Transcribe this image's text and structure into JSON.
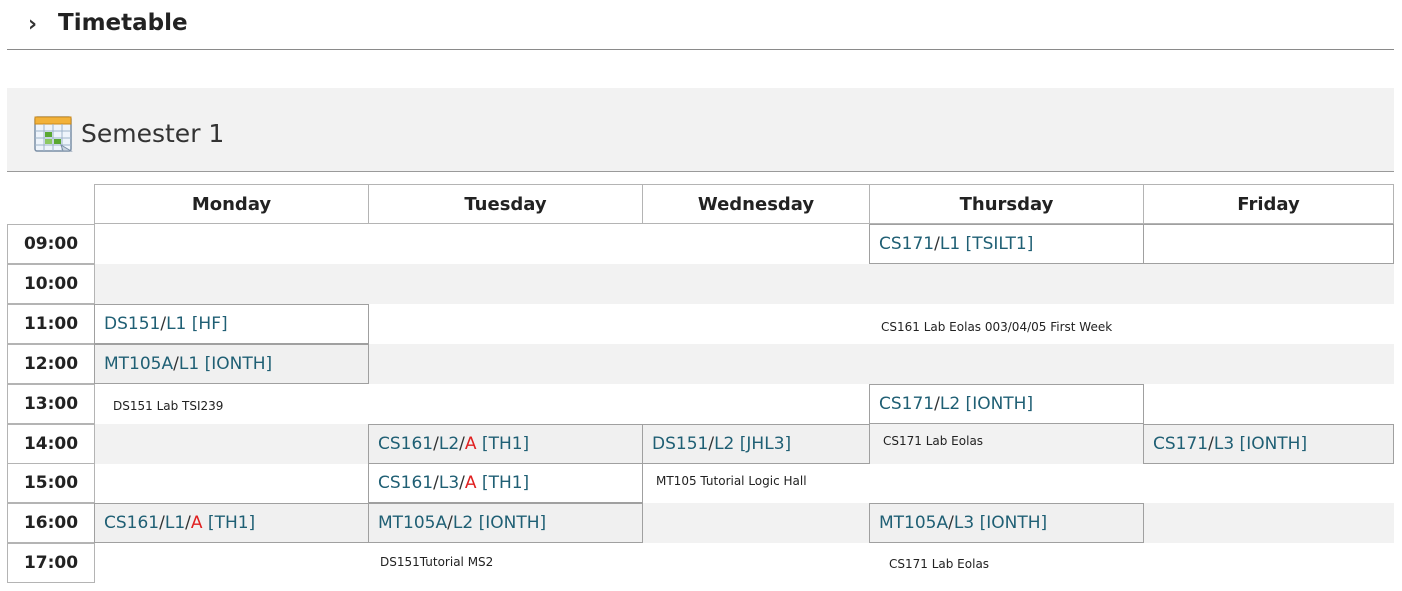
{
  "page": {
    "title": "Timetable",
    "chevron": "›",
    "semester_title": "Semester 1",
    "calendar_icon": "calendar-icon"
  },
  "days": [
    "Monday",
    "Tuesday",
    "Wednesday",
    "Thursday",
    "Friday"
  ],
  "times": [
    "09:00",
    "10:00",
    "11:00",
    "12:00",
    "13:00",
    "14:00",
    "15:00",
    "16:00",
    "17:00"
  ],
  "classes": [
    {
      "code": "CS171",
      "group": "L1",
      "room": "TSILT1"
    },
    {
      "code": "DS151",
      "group": "L1",
      "room": "HF"
    },
    {
      "code": "MT105A",
      "group": "L1",
      "room": "IONTH"
    },
    {
      "code": "CS171",
      "group": "L2",
      "room": "IONTH"
    },
    {
      "code": "CS161",
      "group": "L2",
      "flag": "A",
      "room": "TH1"
    },
    {
      "code": "DS151",
      "group": "L2",
      "room": "JHL3"
    },
    {
      "code": "CS171",
      "group": "L3",
      "room": "IONTH"
    },
    {
      "code": "CS161",
      "group": "L3",
      "flag": "A",
      "room": "TH1"
    },
    {
      "code": "CS161",
      "group": "L1",
      "flag": "A",
      "room": "TH1"
    },
    {
      "code": "MT105A",
      "group": "L2",
      "room": "IONTH"
    },
    {
      "code": "MT105A",
      "group": "L3",
      "room": "IONTH"
    }
  ],
  "notes": [
    "CS161 Lab Eolas 003/04/05 First Week",
    "DS151 Lab TSI239",
    "CS171 Lab Eolas",
    "MT105 Tutorial Logic Hall",
    "DS151Tutorial MS2",
    "CS171 Lab Eolas"
  ],
  "colors": {
    "link": "#1f5f74",
    "flag": "#e02020",
    "band": "#f2f2f2",
    "cell_alt": "#f0f0f0"
  }
}
